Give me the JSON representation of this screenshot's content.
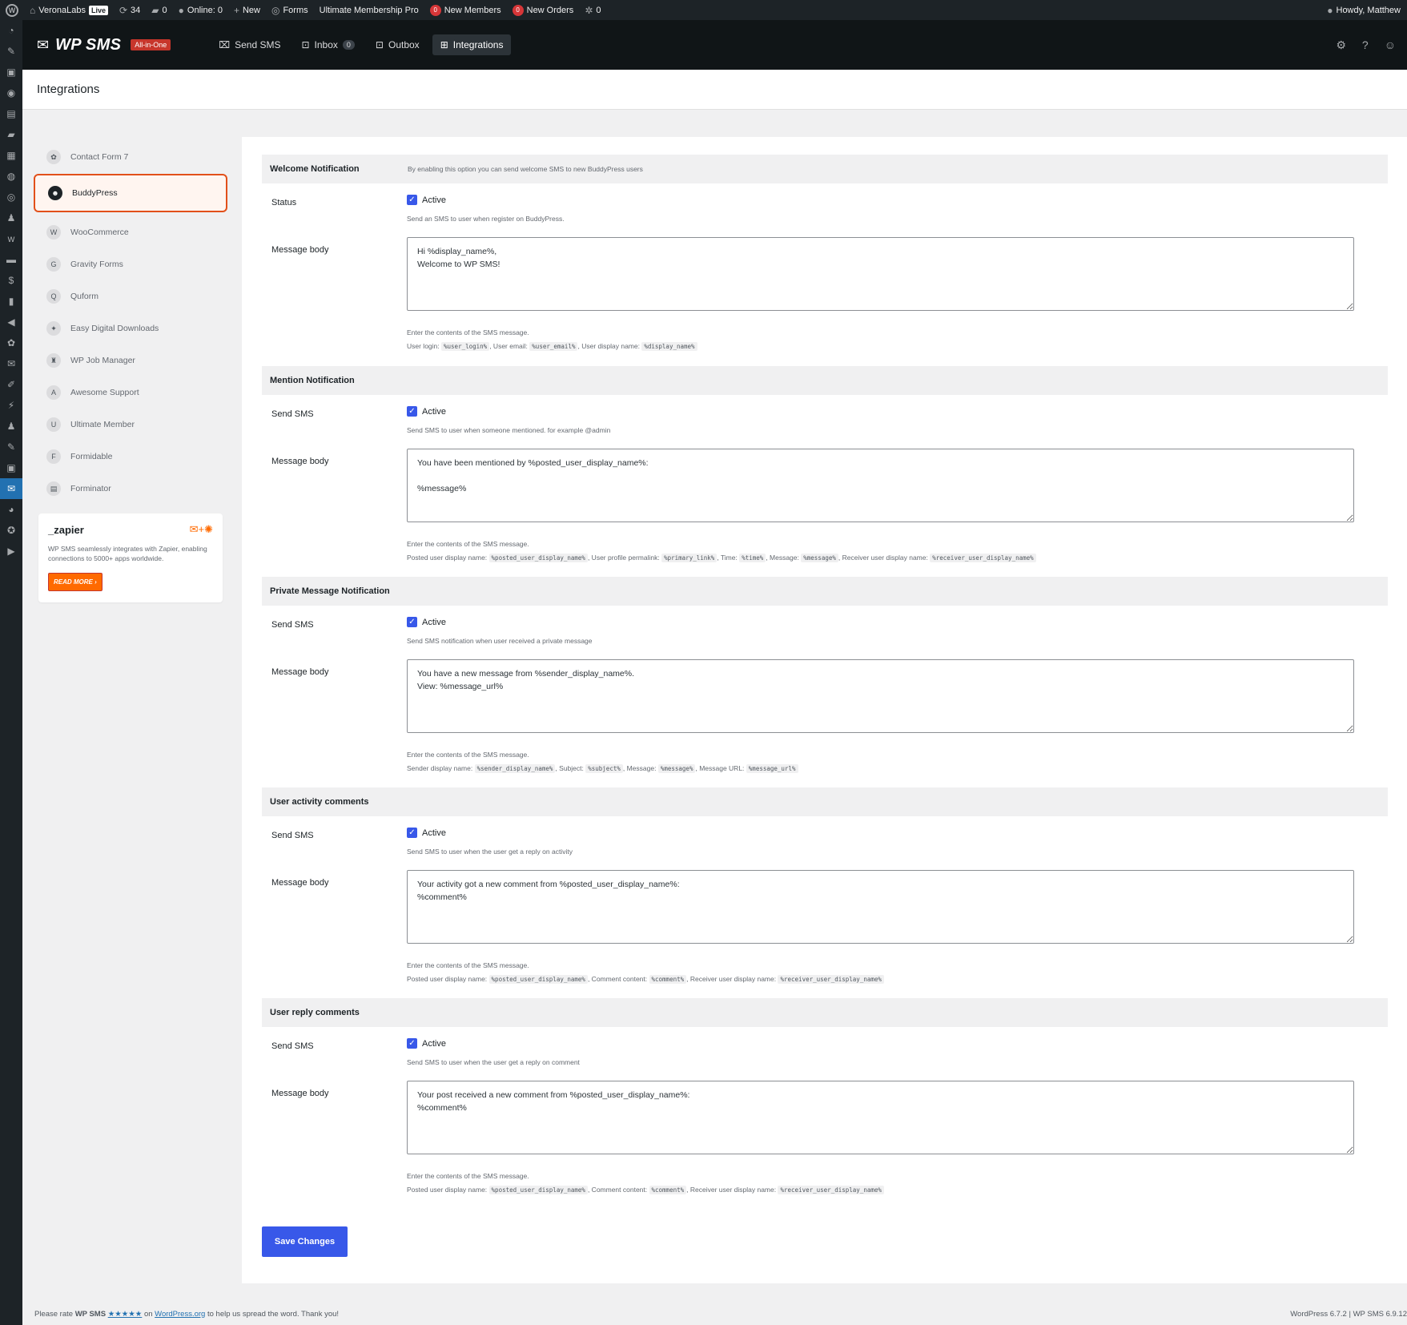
{
  "adminbar": {
    "site_name": "VeronaLabs",
    "live_badge": "Live",
    "updates_count": "34",
    "comments_count": "0",
    "online": "Online: 0",
    "new": "New",
    "forms": "Forms",
    "ump": "Ultimate Membership Pro",
    "new_members_count": "0",
    "new_members": "New Members",
    "new_orders_count": "0",
    "new_orders": "New Orders",
    "misc_count": "0",
    "howdy": "Howdy, Matthew"
  },
  "header": {
    "brand": "WP SMS",
    "badge": "All-in-One",
    "nav": [
      {
        "label": "Send SMS"
      },
      {
        "label": "Inbox",
        "count": "0"
      },
      {
        "label": "Outbox"
      },
      {
        "label": "Integrations"
      }
    ]
  },
  "page": {
    "title": "Integrations"
  },
  "integrations": [
    {
      "label": "Contact Form 7",
      "icon": "contact-form-7-icon"
    },
    {
      "label": "BuddyPress",
      "icon": "buddypress-icon"
    },
    {
      "label": "WooCommerce",
      "icon": "woocommerce-icon"
    },
    {
      "label": "Gravity Forms",
      "icon": "gravity-forms-icon"
    },
    {
      "label": "Quform",
      "icon": "quform-icon"
    },
    {
      "label": "Easy Digital Downloads",
      "icon": "edd-icon"
    },
    {
      "label": "WP Job Manager",
      "icon": "job-manager-icon"
    },
    {
      "label": "Awesome Support",
      "icon": "awesome-support-icon"
    },
    {
      "label": "Ultimate Member",
      "icon": "ultimate-member-icon"
    },
    {
      "label": "Formidable",
      "icon": "formidable-icon"
    },
    {
      "label": "Forminator",
      "icon": "forminator-icon"
    }
  ],
  "zapier": {
    "logo": "_zapier",
    "description": "WP SMS seamlessly integrates with Zapier, enabling connections to 5000+ apps worldwide.",
    "button": "READ MORE ›"
  },
  "sections": [
    {
      "title": "Welcome Notification",
      "description": "By enabling this option you can send welcome SMS to new BuddyPress users",
      "toggle_label": "Status",
      "checkbox_label": "Active",
      "toggle_help": "Send an SMS to user when register on BuddyPress.",
      "message_label": "Message body",
      "message": "Hi %display_name%,\nWelcome to WP SMS!",
      "hint_intro": "Enter the contents of the SMS message.",
      "vars": [
        {
          "label": "User login:",
          "code": "%user_login%"
        },
        {
          "label": ", User email:",
          "code": "%user_email%"
        },
        {
          "label": ", User display name:",
          "code": "%display_name%"
        }
      ]
    },
    {
      "title": "Mention Notification",
      "description": "",
      "toggle_label": "Send SMS",
      "checkbox_label": "Active",
      "toggle_help": "Send SMS to user when someone mentioned. for example @admin",
      "message_label": "Message body",
      "message": "You have been mentioned by %posted_user_display_name%:\n\n%message%",
      "hint_intro": "Enter the contents of the SMS message.",
      "vars": [
        {
          "label": "Posted user display name:",
          "code": "%posted_user_display_name%"
        },
        {
          "label": ", User profile permalink:",
          "code": "%primary_link%"
        },
        {
          "label": ", Time:",
          "code": "%time%"
        },
        {
          "label": ", Message:",
          "code": "%message%"
        },
        {
          "label": ", Receiver user display name:",
          "code": "%receiver_user_display_name%"
        }
      ]
    },
    {
      "title": "Private Message Notification",
      "description": "",
      "toggle_label": "Send SMS",
      "checkbox_label": "Active",
      "toggle_help": "Send SMS notification when user received a private message",
      "message_label": "Message body",
      "message": "You have a new message from %sender_display_name%.\nView: %message_url%",
      "hint_intro": "Enter the contents of the SMS message.",
      "vars": [
        {
          "label": "Sender display name:",
          "code": "%sender_display_name%"
        },
        {
          "label": ", Subject:",
          "code": "%subject%"
        },
        {
          "label": ", Message:",
          "code": "%message%"
        },
        {
          "label": ", Message URL:",
          "code": "%message_url%"
        }
      ]
    },
    {
      "title": "User activity comments",
      "description": "",
      "toggle_label": "Send SMS",
      "checkbox_label": "Active",
      "toggle_help": "Send SMS to user when the user get a reply on activity",
      "message_label": "Message body",
      "message": "Your activity got a new comment from %posted_user_display_name%:\n%comment%",
      "hint_intro": "Enter the contents of the SMS message.",
      "vars": [
        {
          "label": "Posted user display name:",
          "code": "%posted_user_display_name%"
        },
        {
          "label": ", Comment content:",
          "code": "%comment%"
        },
        {
          "label": ", Receiver user display name:",
          "code": "%receiver_user_display_name%"
        }
      ]
    },
    {
      "title": "User reply comments",
      "description": "",
      "toggle_label": "Send SMS",
      "checkbox_label": "Active",
      "toggle_help": "Send SMS to user when the user get a reply on comment",
      "message_label": "Message body",
      "message": "Your post received a new comment from %posted_user_display_name%:\n%comment%",
      "hint_intro": "Enter the contents of the SMS message.",
      "vars": [
        {
          "label": "Posted user display name:",
          "code": "%posted_user_display_name%"
        },
        {
          "label": ", Comment content:",
          "code": "%comment%"
        },
        {
          "label": ", Receiver user display name:",
          "code": "%receiver_user_display_name%"
        }
      ]
    }
  ],
  "save_button": "Save Changes",
  "footer": {
    "rate_prefix": "Please rate",
    "rate_plugin": "WP SMS",
    "stars": "★★★★★",
    "on": "on",
    "wporg": "WordPress.org",
    "rate_suffix": "to help us spread the word. Thank you!",
    "version": "WordPress 6.7.2 | WP SMS 6.9.12"
  },
  "colors": {
    "accent": "#3858e9",
    "highlight": "#e2501a",
    "admin_dark": "#1d2327"
  }
}
